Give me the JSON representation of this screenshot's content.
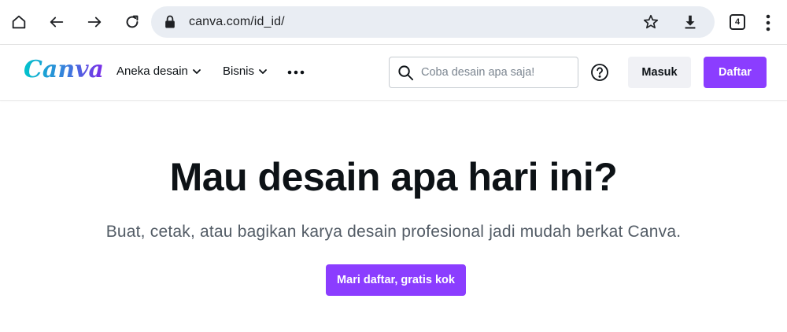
{
  "browser": {
    "url": "canva.com/id_id/",
    "tab_count": "4",
    "icons": [
      "home-icon",
      "back-arrow-icon",
      "forward-arrow-icon",
      "reload-icon",
      "lock-icon",
      "star-icon",
      "download-icon",
      "tabs-icon",
      "more-vertical-icon"
    ]
  },
  "header": {
    "logo": "Canva",
    "nav": [
      {
        "label": "Aneka desain"
      },
      {
        "label": "Bisnis"
      }
    ],
    "search_placeholder": "Coba desain apa saja!",
    "login_label": "Masuk",
    "signup_label": "Daftar"
  },
  "hero": {
    "title": "Mau desain apa hari ini?",
    "subtitle": "Buat, cetak, atau bagikan karya desain profesional jadi mudah berkat Canva.",
    "cta_label": "Mari daftar, gratis kok"
  },
  "colors": {
    "accent": "#8b3dff",
    "omnibox_bg": "#e9edf3",
    "secondary_button_bg": "#f0f1f5"
  }
}
